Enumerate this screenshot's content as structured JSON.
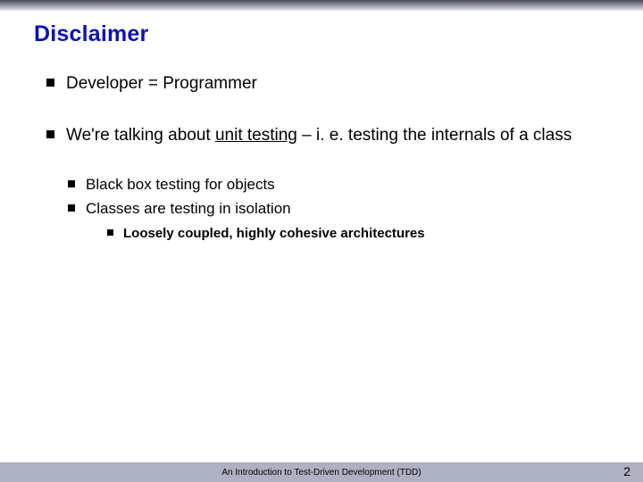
{
  "title": "Disclaimer",
  "bullets": {
    "b1": "Developer = Programmer",
    "b2_pre": "We're talking about ",
    "b2_ul": "unit testing",
    "b2_post": " – i. e. testing the internals of a class",
    "sub1": "Black box testing for objects",
    "sub2": "Classes are testing in isolation",
    "subsub1": "Loosely coupled, highly cohesive architectures"
  },
  "footer": {
    "text": "An Introduction to Test-Driven Development (TDD)",
    "page": "2"
  }
}
